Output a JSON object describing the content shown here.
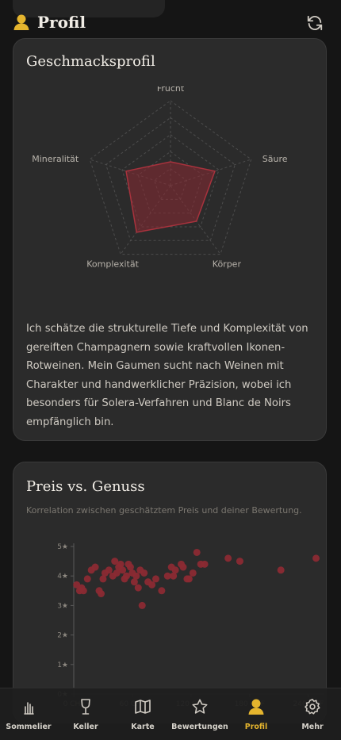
{
  "header": {
    "title": "Profil",
    "accent": "#e5b52e"
  },
  "taste": {
    "title": "Geschmacksprofil",
    "axes": [
      {
        "label": "Frucht",
        "value": 0.28
      },
      {
        "label": "Säure",
        "value": 0.55
      },
      {
        "label": "Körper",
        "value": 0.52
      },
      {
        "label": "Komplexität",
        "value": 0.68
      },
      {
        "label": "Mineralität",
        "value": 0.55
      }
    ],
    "description": "Ich schätze die strukturelle Tiefe und Komplexität von gereiften Champagnern sowie kraftvollen Ikonen-Rotweinen. Mein Gaumen sucht nach Weinen mit Charakter und handwerklicher Präzision, wobei ich besonders für Solera-Verfahren und Blanc de Noirs empfänglich bin.",
    "color": "#8b2a33"
  },
  "price": {
    "title": "Preis vs. Genuss",
    "subtitle": "Korrelation zwischen geschätztem Preis und deiner Bewertung."
  },
  "chart_data": {
    "type": "scatter",
    "title": "Preis vs. Genuss",
    "xlabel": "",
    "ylabel": "",
    "xlim": [
      0,
      250
    ],
    "ylim": [
      0,
      5
    ],
    "x_ticks": [
      "0 CHF",
      "60 CHF",
      "120 CHF",
      "180 CHF",
      "240 CHF"
    ],
    "y_ticks": [
      "0★",
      "1★",
      "2★",
      "3★",
      "4★",
      "5★"
    ],
    "grid": false,
    "color": "#8b2a33",
    "points": [
      [
        3,
        3.7
      ],
      [
        6,
        3.5
      ],
      [
        8,
        3.6
      ],
      [
        10,
        3.5
      ],
      [
        14,
        3.9
      ],
      [
        18,
        4.2
      ],
      [
        22,
        4.3
      ],
      [
        26,
        3.5
      ],
      [
        28,
        3.4
      ],
      [
        30,
        3.9
      ],
      [
        32,
        4.1
      ],
      [
        36,
        4.2
      ],
      [
        40,
        4.0
      ],
      [
        42,
        4.5
      ],
      [
        44,
        4.1
      ],
      [
        46,
        4.3
      ],
      [
        48,
        4.4
      ],
      [
        50,
        4.2
      ],
      [
        52,
        3.9
      ],
      [
        54,
        4.0
      ],
      [
        56,
        4.4
      ],
      [
        58,
        4.3
      ],
      [
        60,
        4.1
      ],
      [
        62,
        3.8
      ],
      [
        64,
        4.0
      ],
      [
        66,
        3.6
      ],
      [
        68,
        4.2
      ],
      [
        70,
        3.0
      ],
      [
        72,
        4.1
      ],
      [
        76,
        3.8
      ],
      [
        80,
        3.7
      ],
      [
        84,
        3.9
      ],
      [
        90,
        3.5
      ],
      [
        96,
        4.0
      ],
      [
        100,
        4.3
      ],
      [
        102,
        4.0
      ],
      [
        104,
        4.2
      ],
      [
        110,
        4.4
      ],
      [
        112,
        4.3
      ],
      [
        116,
        3.9
      ],
      [
        118,
        3.9
      ],
      [
        122,
        4.1
      ],
      [
        126,
        4.8
      ],
      [
        130,
        4.4
      ],
      [
        134,
        4.4
      ],
      [
        158,
        4.6
      ],
      [
        170,
        4.5
      ],
      [
        212,
        4.2
      ],
      [
        248,
        4.6
      ]
    ]
  },
  "nav": {
    "items": [
      {
        "label": "Sommelier",
        "icon": "hand-bell-icon",
        "active": false
      },
      {
        "label": "Keller",
        "icon": "wine-glass-icon",
        "active": false
      },
      {
        "label": "Karte",
        "icon": "map-icon",
        "active": false
      },
      {
        "label": "Bewertungen",
        "icon": "star-icon",
        "active": false
      },
      {
        "label": "Profil",
        "icon": "user-icon",
        "active": true
      },
      {
        "label": "Mehr",
        "icon": "gear-icon",
        "active": false
      }
    ]
  }
}
